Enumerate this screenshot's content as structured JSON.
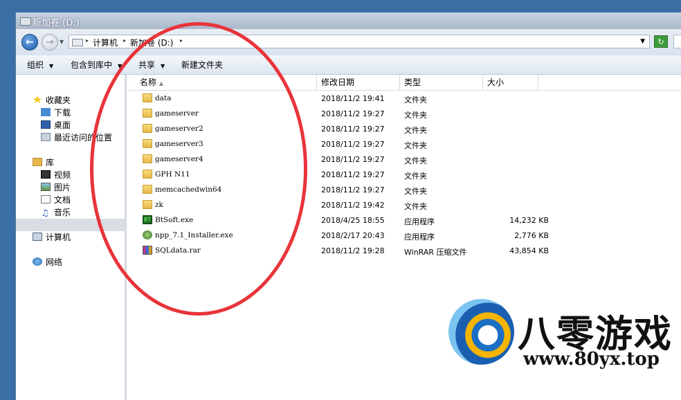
{
  "window": {
    "title": "新加卷 (D:)"
  },
  "address": {
    "crumbs": [
      "计算机",
      "新加卷 (D:)"
    ]
  },
  "toolbar": {
    "organize": "组织",
    "include_in_library": "包含到库中",
    "share": "共享",
    "new_folder": "新建文件夹"
  },
  "nav": {
    "favorites": "收藏夹",
    "downloads": "下载",
    "desktop": "桌面",
    "recent": "最近访问的位置",
    "libraries": "库",
    "videos": "视频",
    "pictures": "图片",
    "documents": "文档",
    "music": "音乐",
    "computer": "计算机",
    "network": "网络"
  },
  "columns": {
    "name": "名称",
    "modified": "修改日期",
    "type": "类型",
    "size": "大小"
  },
  "files": [
    {
      "name": "data",
      "modified": "2018/11/2 19:41",
      "type": "文件夹",
      "size": "",
      "icon": "folder"
    },
    {
      "name": "gameserver",
      "modified": "2018/11/2 19:27",
      "type": "文件夹",
      "size": "",
      "icon": "folder"
    },
    {
      "name": "gameserver2",
      "modified": "2018/11/2 19:27",
      "type": "文件夹",
      "size": "",
      "icon": "folder"
    },
    {
      "name": "gameserver3",
      "modified": "2018/11/2 19:27",
      "type": "文件夹",
      "size": "",
      "icon": "folder"
    },
    {
      "name": "gameserver4",
      "modified": "2018/11/2 19:27",
      "type": "文件夹",
      "size": "",
      "icon": "folder"
    },
    {
      "name": "GPH N11",
      "modified": "2018/11/2 19:27",
      "type": "文件夹",
      "size": "",
      "icon": "folder"
    },
    {
      "name": "memcachedwin64",
      "modified": "2018/11/2 19:27",
      "type": "文件夹",
      "size": "",
      "icon": "folder"
    },
    {
      "name": "zk",
      "modified": "2018/11/2 19:42",
      "type": "文件夹",
      "size": "",
      "icon": "folder"
    },
    {
      "name": "BtSoft.exe",
      "modified": "2018/4/25 18:55",
      "type": "应用程序",
      "size": "14,232 KB",
      "icon": "bt"
    },
    {
      "name": "npp_7.1_Installer.exe",
      "modified": "2018/2/17 20:43",
      "type": "应用程序",
      "size": "2,776 KB",
      "icon": "npp"
    },
    {
      "name": "SQLdata.rar",
      "modified": "2018/11/2 19:28",
      "type": "WinRAR 压缩文件",
      "size": "43,854 KB",
      "icon": "rar"
    }
  ],
  "watermark": {
    "brand": "八零游戏",
    "url": "www.80yx.top"
  },
  "colors": {
    "annotation_circle": "#e8343a",
    "desktop": "#3a6ea5"
  }
}
